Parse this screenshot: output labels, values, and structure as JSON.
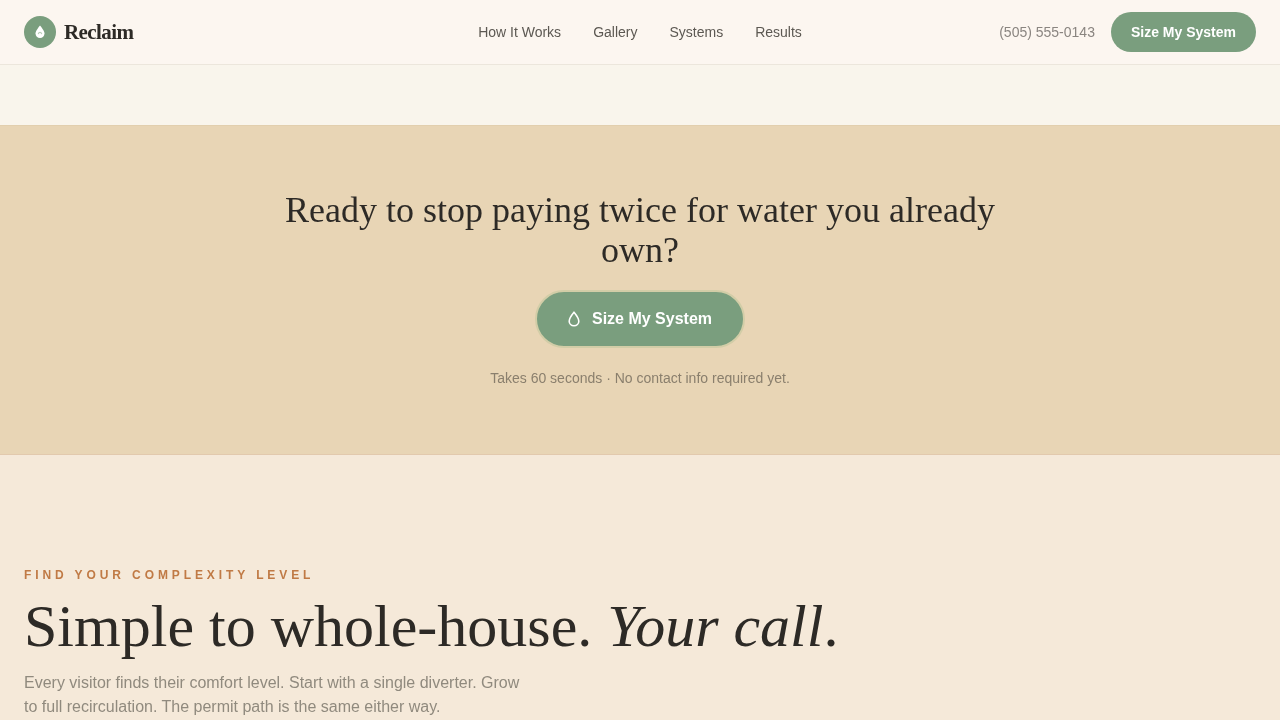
{
  "header": {
    "brand": "Reclaim",
    "nav": [
      "How It Works",
      "Gallery",
      "Systems",
      "Results"
    ],
    "phone": "(505) 555-0143",
    "cta": "Size My System"
  },
  "cta_section": {
    "heading": "Ready to stop paying twice for water you already own?",
    "button": "Size My System",
    "note": "Takes 60 seconds · No contact info required yet."
  },
  "levels_section": {
    "eyebrow": "FIND YOUR COMPLEXITY LEVEL",
    "heading": "Simple to whole-house. *Your call*.",
    "intro": "Every visitor finds their comfort level. Start with a single diverter. Grow to full recirculation. The permit path is the same either way."
  }
}
